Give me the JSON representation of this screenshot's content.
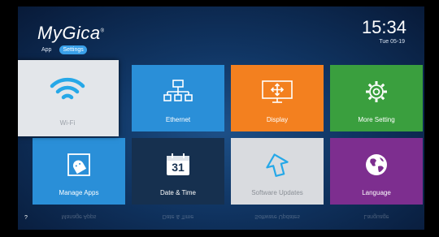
{
  "header": {
    "brand": "MyGica",
    "tabs": [
      {
        "label": "App",
        "active": false
      },
      {
        "label": "Settings",
        "active": true
      }
    ],
    "time": "15:34",
    "date": "Tue 05-19"
  },
  "tiles": [
    {
      "label": "Wi-Fi",
      "icon": "wifi-icon",
      "color": "#e3e6ea",
      "focused": true
    },
    {
      "label": "Ethernet",
      "icon": "network-icon",
      "color": "#2a8fd8"
    },
    {
      "label": "Display",
      "icon": "display-icon",
      "color": "#f3801f"
    },
    {
      "label": "More Setting",
      "icon": "gear-icon",
      "color": "#3a9f3e"
    },
    {
      "label": "Manage Apps",
      "icon": "android-icon",
      "color": "#2a8fd8"
    },
    {
      "label": "Date & Time",
      "icon": "calendar-icon",
      "color": "#16304f",
      "day": "31"
    },
    {
      "label": "Software Updates",
      "icon": "update-arrow-icon",
      "color": "#d9dbdf"
    },
    {
      "label": "Language",
      "icon": "globe-icon",
      "color": "#7d2e8f"
    }
  ],
  "footer": {
    "help": "?"
  }
}
